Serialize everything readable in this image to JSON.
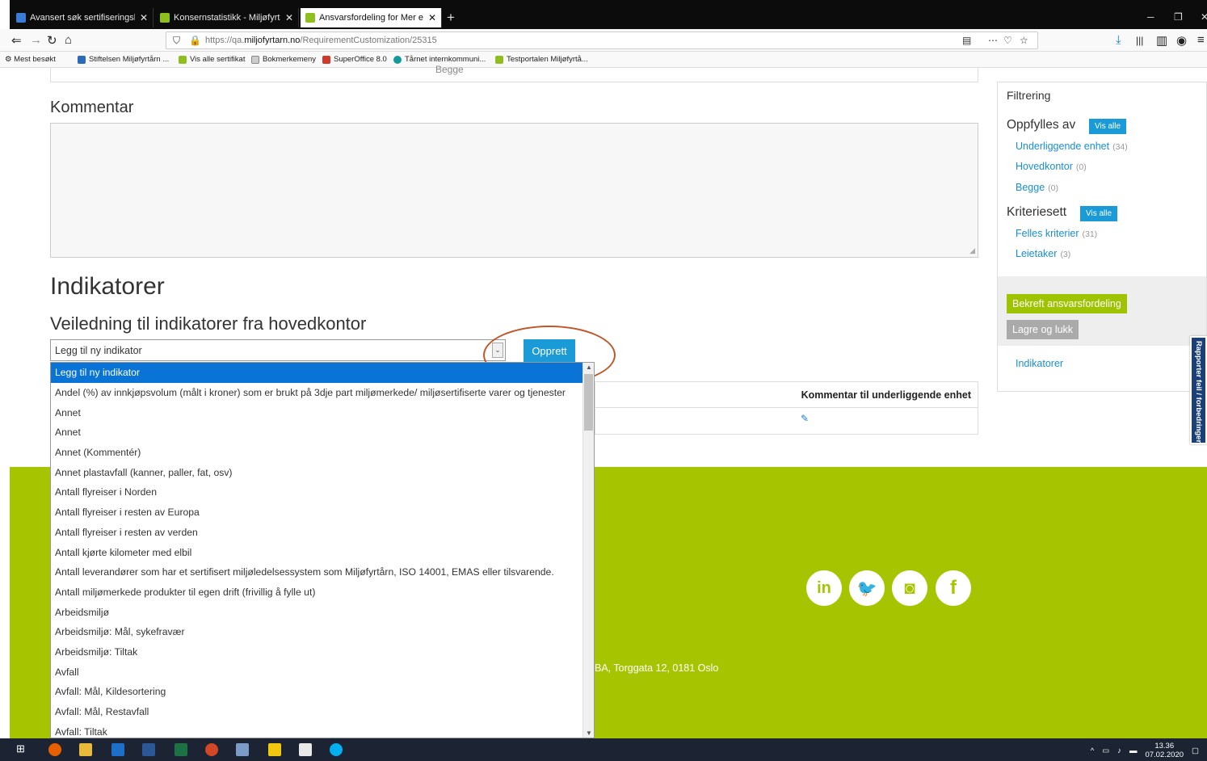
{
  "browser": {
    "tabs": [
      {
        "label": "Avansert søk sertifiseringskriter",
        "color": "#3a7bd5"
      },
      {
        "label": "Konsernstatistikk - Miljøfyrtårn",
        "color": "#8fbf1f"
      },
      {
        "label": "Ansvarsfordeling for Mer enn k",
        "color": "#8fbf1f"
      }
    ],
    "url_prefix": "https://qa.",
    "url_domain": "miljofyrtarn.no",
    "url_path": "/RequirementCustomization/25315",
    "bookmarks": [
      "Mest besøkt",
      "Stiftelsen Miljøfyrtårn ...",
      "Vis alle sertifikat",
      "Bokmerkemeny",
      "SuperOffice 8.0",
      "Tårnet internkommuni...",
      "Testportalen Miljøfyrtå..."
    ]
  },
  "page": {
    "partial_option": "Begge",
    "comment_heading": "Kommentar",
    "indicators_heading": "Indikatorer",
    "guidance_heading": "Veiledning til indikatorer fra hovedkontor",
    "select_value": "Legg til ny indikator",
    "create_button": "Opprett",
    "table_header": "Kommentar til underliggende enhet"
  },
  "sidebar": {
    "title": "Filtrering",
    "group1": {
      "label": "Oppfylles av",
      "show_all": "Vis alle"
    },
    "group1_items": [
      {
        "label": "Underliggende enhet",
        "count": "(34)"
      },
      {
        "label": "Hovedkontor",
        "count": "(0)"
      },
      {
        "label": "Begge",
        "count": "(0)"
      }
    ],
    "group2": {
      "label": "Kriteriesett",
      "show_all": "Vis alle"
    },
    "group2_items": [
      {
        "label": "Felles kriterier",
        "count": "(31)"
      },
      {
        "label": "Leietaker",
        "count": "(3)"
      }
    ],
    "confirm_button": "Bekreft ansvarsfordeling",
    "save_close_button": "Lagre og lukk",
    "indicators_link": "Indikatorer"
  },
  "feedback_tab": "Rapporter feil / forbedringer",
  "footer": {
    "address": "BA, Torggata 12, 0181 Oslo",
    "social": [
      "in",
      "t",
      "ig",
      "f"
    ]
  },
  "dropdown_options": [
    "Legg til ny indikator",
    "Andel (%) av innkjøpsvolum (målt i kroner) som er brukt på 3dje part miljømerkede/ miljøsertifiserte varer og tjenester",
    "Annet",
    "Annet",
    "Annet (Kommentér)",
    "Annet plastavfall (kanner, paller, fat, osv)",
    "Antall flyreiser i Norden",
    "Antall flyreiser i resten av Europa",
    "Antall flyreiser i resten av verden",
    "Antall kjørte kilometer med elbil",
    "Antall leverandører som har et sertifisert miljøledelsessystem som Miljøfyrtårn, ISO 14001, EMAS eller tilsvarende.",
    "Antall miljømerkede produkter til egen drift (frivillig å fylle ut)",
    "Arbeidsmiljø",
    "Arbeidsmiljø: Mål, sykefravær",
    "Arbeidsmiljø: Tiltak",
    "Avfall",
    "Avfall: Mål, Kildesortering",
    "Avfall: Mål, Restavfall",
    "Avfall: Tiltak"
  ],
  "taskbar": {
    "time": "13.36",
    "date": "07.02.2020"
  },
  "colors": {
    "accent_blue": "#1a9ad6",
    "brand_green": "#a6c500",
    "annotation_ring": "#c0562b"
  }
}
